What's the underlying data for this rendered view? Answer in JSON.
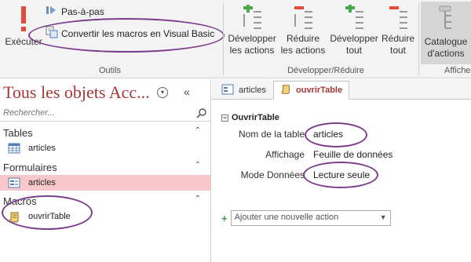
{
  "ribbon": {
    "run_label": "Exécuter",
    "step_label": "Pas-à-pas",
    "convert_label": "Convertir les macros en Visual Basic",
    "group_tools_label": "Outils",
    "expand_actions": [
      "Développer",
      "les actions"
    ],
    "collapse_actions": [
      "Réduire",
      "les actions"
    ],
    "expand_all": [
      "Développer",
      "tout"
    ],
    "collapse_all": [
      "Réduire",
      "tout"
    ],
    "group_expand_label": "Développer/Réduire",
    "catalog": [
      "Catalogue",
      "d'actions"
    ],
    "group_show_label": "Affiche"
  },
  "nav": {
    "title": "Tous les objets Acc...",
    "search_placeholder": "Rechercher...",
    "collapse_glyph": "«",
    "sections": [
      {
        "label": "Tables",
        "items": [
          {
            "label": "articles",
            "icon": "table-icon",
            "selected": false
          }
        ]
      },
      {
        "label": "Formulaires",
        "items": [
          {
            "label": "articles",
            "icon": "form-icon",
            "selected": true
          }
        ]
      },
      {
        "label": "Macros",
        "items": [
          {
            "label": "ouvrirTable",
            "icon": "macro-scroll-icon",
            "selected": false
          }
        ]
      }
    ]
  },
  "tabs": [
    {
      "label": "articles",
      "icon": "form-icon",
      "active": false
    },
    {
      "label": "ouvrirTable",
      "icon": "macro-scroll-icon",
      "active": true
    }
  ],
  "macro": {
    "action_name": "OuvrirTable",
    "args": [
      {
        "label": "Nom de la table",
        "value": "articles"
      },
      {
        "label": "Affichage",
        "value": "Feuille de données"
      },
      {
        "label": "Mode Données",
        "value": "Lecture seule"
      }
    ],
    "add_action_placeholder": "Ajouter une nouvelle action"
  },
  "colors": {
    "accent_red": "#a4373a",
    "selected_pink": "#f8c7c9",
    "highlight_purple": "#7b3d8c"
  }
}
